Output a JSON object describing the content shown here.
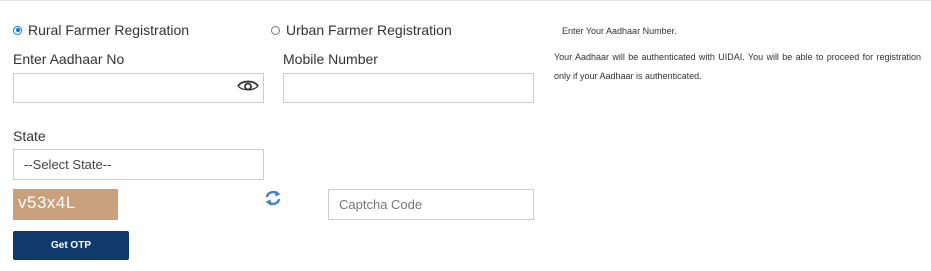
{
  "registration_type": {
    "rural_label": "Rural Farmer Registration",
    "urban_label": "Urban Farmer Registration",
    "selected": "rural"
  },
  "form": {
    "aadhaar_label": "Enter Aadhaar No",
    "aadhaar_value": "",
    "mobile_label": "Mobile Number",
    "mobile_value": "",
    "state_label": "State",
    "state_selected": "--Select State--",
    "captcha_text": "v53x4L",
    "captcha_placeholder": "Captcha Code",
    "get_otp_label": "Get OTP"
  },
  "info": {
    "title": "Enter Your Aadhaar Number.",
    "description": "Your Aadhaar will be authenticated with UIDAI. You will be able to proceed for registration only if your Aadhaar is authenticated."
  },
  "icons": {
    "eye": "eye-icon",
    "refresh": "refresh-icon"
  },
  "colors": {
    "radio_accent": "#0075ff",
    "button_bg": "#0f3a6b",
    "captcha_bg": "#c8a07e",
    "refresh_icon": "#3f7fd6"
  }
}
